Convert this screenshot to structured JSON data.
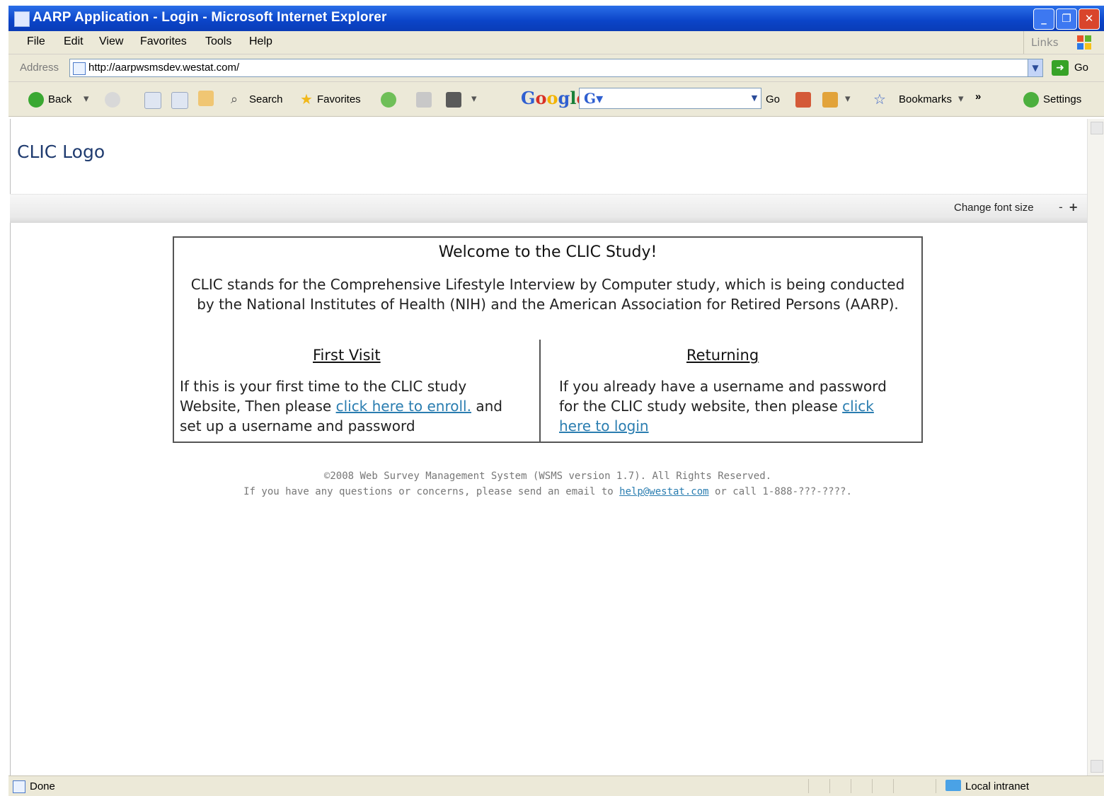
{
  "window": {
    "title": "AARP Application - Login - Microsoft Internet Explorer",
    "minimize_label": "_",
    "maximize_label": "❐",
    "close_label": "✕"
  },
  "menu": {
    "items": [
      "File",
      "Edit",
      "View",
      "Favorites",
      "Tools",
      "Help"
    ],
    "links_label": "Links"
  },
  "address_bar": {
    "label": "Address",
    "url": "http://aarpwsmsdev.westat.com/",
    "go_label": "Go"
  },
  "toolbar": {
    "back_label": "Back",
    "search_label": "Search",
    "favorites_label": "Favorites",
    "google_search_go": "Go",
    "bookmarks_label": "Bookmarks",
    "more_label": "»",
    "settings_label": "Settings"
  },
  "page": {
    "logo_text": "CLIC Logo",
    "font_size_label": "Change font size",
    "font_minus": "-",
    "font_plus": "+",
    "welcome_title": "Welcome to the CLIC Study!",
    "welcome_description": "CLIC stands for the Comprehensive Lifestyle Interview by Computer study, which is being conducted by the National Institutes of Health (NIH) and the American Association for Retired Persons (AARP).",
    "first_visit": {
      "heading": "First Visit",
      "text_before": "If this is your first time to the CLIC study Website, Then please ",
      "link": "click here to enroll.",
      "text_after": " and set up a username and password"
    },
    "returning": {
      "heading": "Returning",
      "text_before": "If you already have a username and password for the CLIC study website, then please ",
      "link": "click here to login"
    },
    "footer": {
      "copyright": "©2008 Web Survey Management System (WSMS version 1.7). All Rights Reserved.",
      "contact_before": "If you have any questions or concerns, please send an email to ",
      "email": "help@westat.com",
      "contact_after": " or call 1-888-???-????."
    }
  },
  "status_bar": {
    "status": "Done",
    "zone": "Local intranet"
  },
  "colors": {
    "titlebar": "#0b44c8",
    "link": "#2a7db0",
    "chrome": "#ece9d8"
  }
}
